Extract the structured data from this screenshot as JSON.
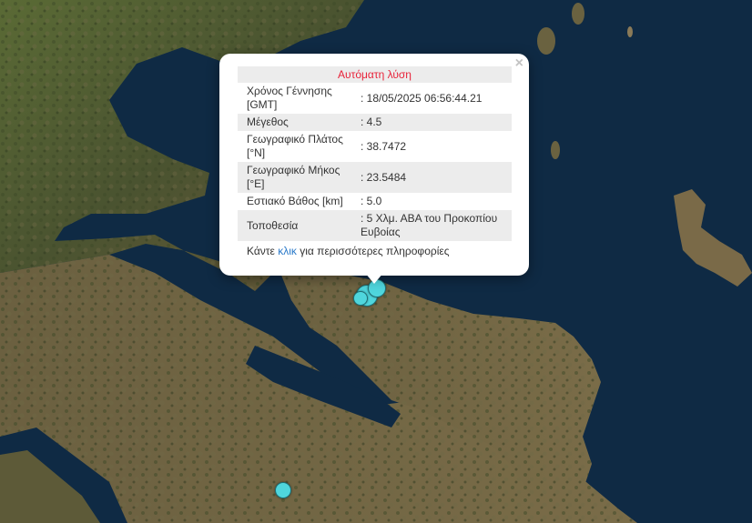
{
  "popup": {
    "header": "Αυτόματη λύση",
    "rows": [
      {
        "key": "Χρόνος Γέννησης [GMT]",
        "value": ": 18/05/2025 06:56:44.21"
      },
      {
        "key": "Μέγεθος",
        "value": ": 4.5"
      },
      {
        "key": "Γεωγραφικό Πλάτος [°N]",
        "value": ": 38.7472"
      },
      {
        "key": "Γεωγραφικό Μήκος [°E]",
        "value": ": 23.5484"
      },
      {
        "key": "Εστιακό Βάθος [km]",
        "value": ": 5.0"
      },
      {
        "key": "Τοποθεσία",
        "value": ": 5 Χλμ. ΑΒΑ του Προκοπίου Ευβοίας"
      }
    ],
    "more_prefix": "Κάντε ",
    "more_link": "κλικ",
    "more_suffix": " για περισσότερες πληροφορίες",
    "close_glyph": "×"
  },
  "colors": {
    "sea": "#0f2a44",
    "land": "#4f5a30",
    "marker": "#4fd6dd",
    "header_text": "#e8233a",
    "link": "#2a79c9"
  }
}
